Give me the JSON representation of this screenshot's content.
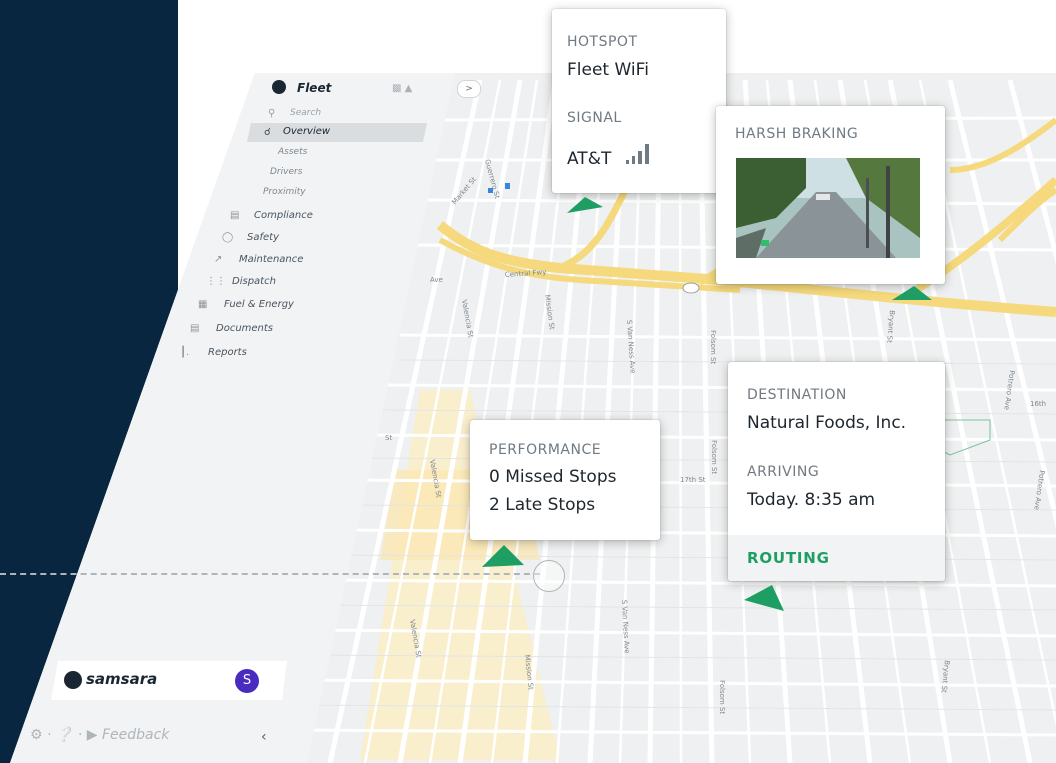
{
  "sidebar": {
    "title": "Fleet",
    "search_placeholder": "Search",
    "items": [
      {
        "label": "Overview",
        "icon": "vehicle-icon",
        "active": true
      },
      {
        "label": "Assets",
        "sub": true
      },
      {
        "label": "Drivers",
        "sub": true
      },
      {
        "label": "Proximity",
        "sub": true
      },
      {
        "label": "Compliance",
        "icon": "compliance-icon"
      },
      {
        "label": "Safety",
        "icon": "shield-icon"
      },
      {
        "label": "Maintenance",
        "icon": "wrench-icon"
      },
      {
        "label": "Dispatch",
        "icon": "dispatch-icon"
      },
      {
        "label": "Fuel & Energy",
        "icon": "fuel-icon"
      },
      {
        "label": "Documents",
        "icon": "document-icon"
      },
      {
        "label": "Reports",
        "icon": "reports-icon"
      }
    ],
    "brand": "samsara",
    "avatar_initial": "S",
    "footer": {
      "feedback": "Feedback"
    }
  },
  "popups": {
    "hotspot": {
      "label": "HOTSPOT",
      "value": "Fleet WiFi",
      "signal_label": "SIGNAL",
      "signal_value": "AT&T"
    },
    "harsh_braking": {
      "label": "HARSH BRAKING"
    },
    "performance": {
      "label": "PERFORMANCE",
      "missed": "0 Missed Stops",
      "late": "2 Late Stops"
    },
    "destination": {
      "label": "DESTINATION",
      "value": "Natural Foods, Inc.",
      "arriving_label": "ARRIVING",
      "arriving_value": "Today. 8:35 am",
      "action": "ROUTING"
    }
  },
  "map": {
    "streets": [
      "Central Fwy",
      "Valencia St",
      "Mission St",
      "S Van Ness Ave",
      "Folsom St",
      "Bryant St",
      "17th St",
      "16th St",
      "Potrero Ave",
      "Market St",
      "Howard St",
      "Guerrero St",
      "Duboce Ave"
    ]
  },
  "colors": {
    "navy": "#082640",
    "routing_green": "#1f9e63",
    "avatar_purple": "#4a2bbf",
    "freeway_yellow": "#f5d97c"
  }
}
